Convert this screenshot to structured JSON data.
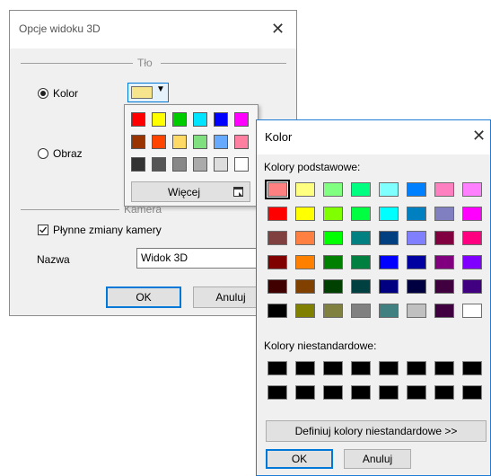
{
  "dialog1": {
    "title": "Opcje widoku 3D",
    "background_group": "Tło",
    "radio_color": "Kolor",
    "radio_image": "Obraz",
    "camera_group": "Kamera",
    "checkbox_smooth": "Płynne zmiany kamery",
    "name_label": "Nazwa",
    "name_value": "Widok 3D",
    "ok_label": "OK",
    "cancel_label": "Anuluj",
    "selected_color": "#f6e58c"
  },
  "popup": {
    "rows": [
      [
        "#ff0000",
        "#ffff00",
        "#00cc00",
        "#00e5ff",
        "#0000ff",
        "#ff00ff"
      ],
      [
        "#993300",
        "#ff4400",
        "#ffd966",
        "#80e080",
        "#66aaff",
        "#ff7fa0"
      ],
      [
        "#333333",
        "#555555",
        "#888888",
        "#aaaaaa",
        "#dddddd",
        "#ffffff"
      ]
    ],
    "more_label": "Więcej"
  },
  "dialog2": {
    "title": "Kolor",
    "basic_label": "Kolory podstawowe:",
    "custom_label": "Kolory niestandardowe:",
    "define_label": "Definiuj kolory niestandardowe >>",
    "ok_label": "OK",
    "cancel_label": "Anuluj",
    "basic_rows": [
      [
        "#ff8080",
        "#ffff80",
        "#80ff80",
        "#00ff80",
        "#80ffff",
        "#0080ff",
        "#ff80c0",
        "#ff80ff"
      ],
      [
        "#ff0000",
        "#ffff00",
        "#80ff00",
        "#00ff40",
        "#00ffff",
        "#0080c0",
        "#8080c0",
        "#ff00ff"
      ],
      [
        "#804040",
        "#ff8040",
        "#00ff00",
        "#008080",
        "#004080",
        "#8080ff",
        "#800040",
        "#ff0080"
      ],
      [
        "#800000",
        "#ff8000",
        "#008000",
        "#008040",
        "#0000ff",
        "#0000a0",
        "#800080",
        "#8000ff"
      ],
      [
        "#400000",
        "#804000",
        "#004000",
        "#004040",
        "#000080",
        "#000040",
        "#400040",
        "#400080"
      ],
      [
        "#000000",
        "#808000",
        "#808040",
        "#808080",
        "#408080",
        "#c0c0c0",
        "#400040",
        "#ffffff"
      ]
    ],
    "custom_rows": [
      [
        "#000000",
        "#000000",
        "#000000",
        "#000000",
        "#000000",
        "#000000",
        "#000000",
        "#000000"
      ],
      [
        "#000000",
        "#000000",
        "#000000",
        "#000000",
        "#000000",
        "#000000",
        "#000000",
        "#000000"
      ]
    ]
  }
}
